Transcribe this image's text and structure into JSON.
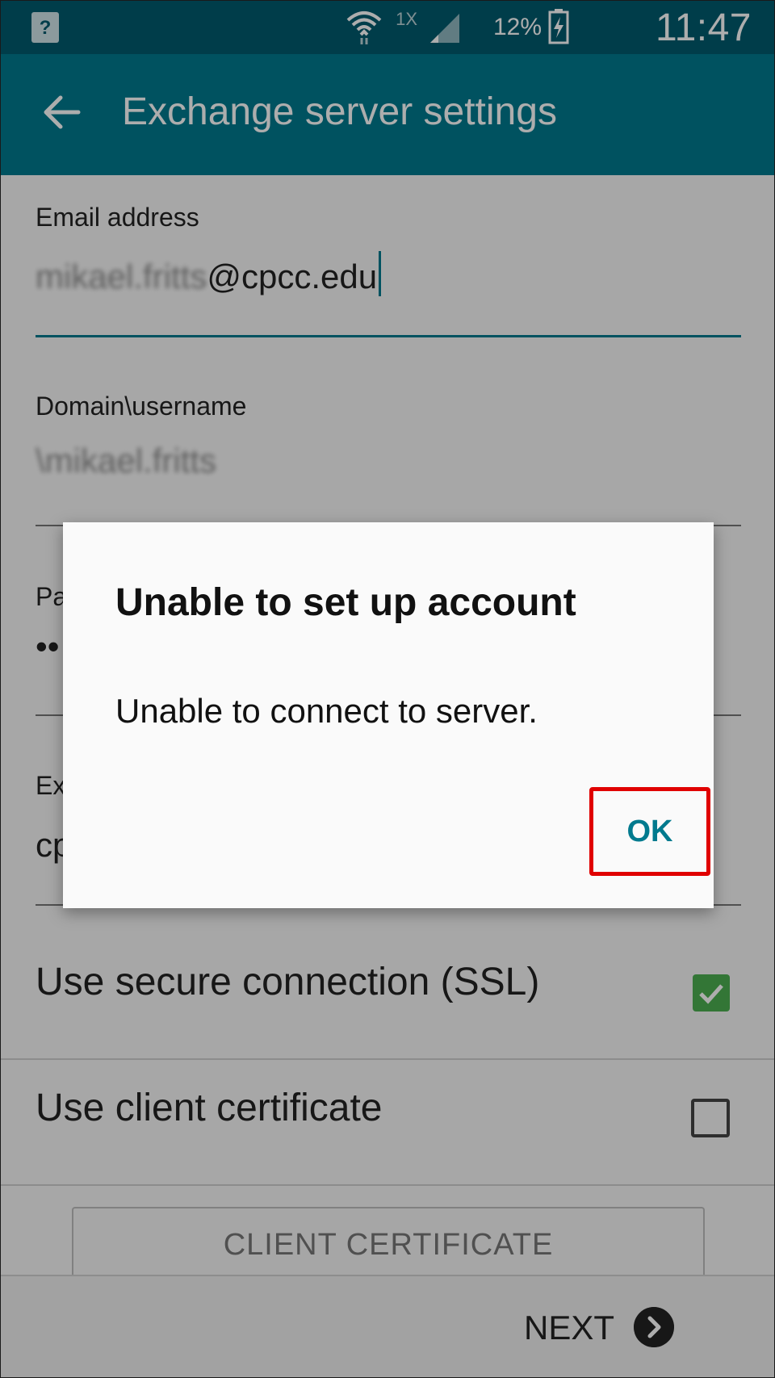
{
  "status_bar": {
    "notification_icon": "?",
    "network_label": "1X",
    "battery_percent": "12%",
    "time": "11:47 AM"
  },
  "app_bar": {
    "title": "Exchange server settings",
    "back_icon": "arrow-left-icon"
  },
  "form": {
    "email": {
      "label": "Email address",
      "value_blurred": "mikael.fritts",
      "value_visible": "@cpcc.edu"
    },
    "domain_username": {
      "label": "Domain\\username",
      "value_blurred": "\\mikael.fritts"
    },
    "password": {
      "label_partial": "Pa",
      "value_partial": "••"
    },
    "exchange_server": {
      "label_partial": "Ex",
      "value_partial": "cp"
    },
    "ssl": {
      "label": "Use secure connection (SSL)",
      "checked": true
    },
    "client_cert": {
      "label": "Use client certificate",
      "checked": false
    },
    "client_cert_button": "CLIENT CERTIFICATE",
    "next_button": "NEXT"
  },
  "dialog": {
    "title": "Unable to set up account",
    "message": "Unable to connect to server.",
    "ok_button": "OK",
    "highlight_color": "#e00000"
  },
  "colors": {
    "status_bar": "#005a6e",
    "app_bar": "#007a8e",
    "accent": "#007a8e",
    "checkbox_checked": "#4caf50"
  }
}
